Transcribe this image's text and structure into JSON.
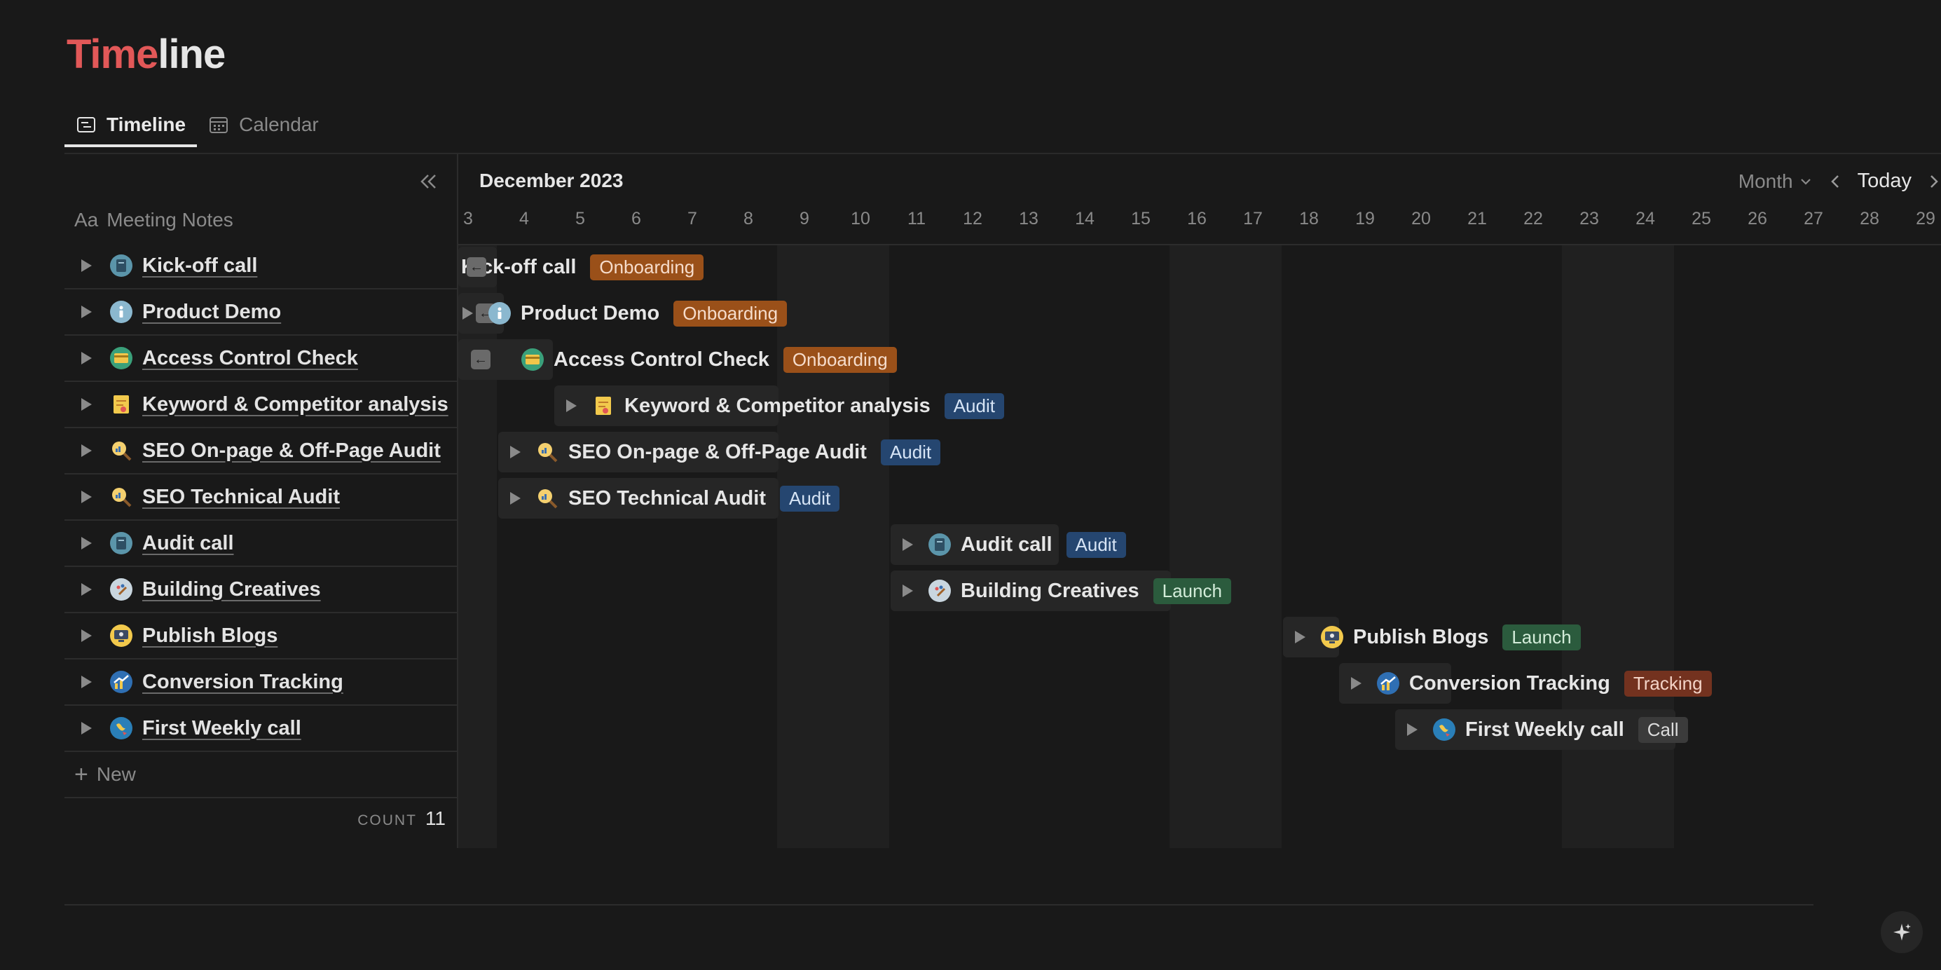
{
  "page": {
    "title_highlight": "Time",
    "title_rest": "line"
  },
  "tabs": [
    {
      "label": "Timeline",
      "icon": "timeline-icon",
      "active": true
    },
    {
      "label": "Calendar",
      "icon": "calendar-icon",
      "active": false
    }
  ],
  "table": {
    "column_prefix": "Aa",
    "column_header": "Meeting Notes",
    "new_label": "New",
    "count_label": "COUNT",
    "count_value": "11"
  },
  "rows": [
    {
      "label": "Kick-off call",
      "icon": "notebook-icon",
      "tag": "Onboarding"
    },
    {
      "label": "Product Demo",
      "icon": "info-icon",
      "tag": "Onboarding"
    },
    {
      "label": "Access Control Check",
      "icon": "credit-card-icon",
      "tag": "Onboarding"
    },
    {
      "label": "Keyword & Competitor analysis",
      "icon": "notepad-icon",
      "tag": "Audit"
    },
    {
      "label": "SEO On-page & Off-Page Audit",
      "icon": "magnifier-chart-icon",
      "tag": "Audit"
    },
    {
      "label": "SEO Technical Audit",
      "icon": "magnifier-chart-icon",
      "tag": "Audit"
    },
    {
      "label": "Audit call",
      "icon": "notebook-icon",
      "tag": "Audit"
    },
    {
      "label": "Building Creatives",
      "icon": "palette-icon",
      "tag": "Launch"
    },
    {
      "label": "Publish Blogs",
      "icon": "monitor-icon",
      "tag": "Launch"
    },
    {
      "label": "Conversion Tracking",
      "icon": "chart-up-icon",
      "tag": "Tracking"
    },
    {
      "label": "First Weekly call",
      "icon": "globe-icon",
      "tag": "Call"
    }
  ],
  "timeline": {
    "month_label": "December 2023",
    "view_label": "Month",
    "today_label": "Today",
    "days": [
      "3",
      "4",
      "5",
      "6",
      "7",
      "8",
      "9",
      "10",
      "11",
      "12",
      "13",
      "14",
      "15",
      "16",
      "17",
      "18",
      "19",
      "20",
      "21",
      "22",
      "23",
      "24",
      "25",
      "26",
      "27",
      "28",
      "29"
    ]
  },
  "colors": {
    "accent_title": "#e25858",
    "onboarding": "#9a5019",
    "audit": "#254670",
    "launch": "#2b5b3d",
    "tracking": "#73321f",
    "call": "#3b3b3b"
  }
}
